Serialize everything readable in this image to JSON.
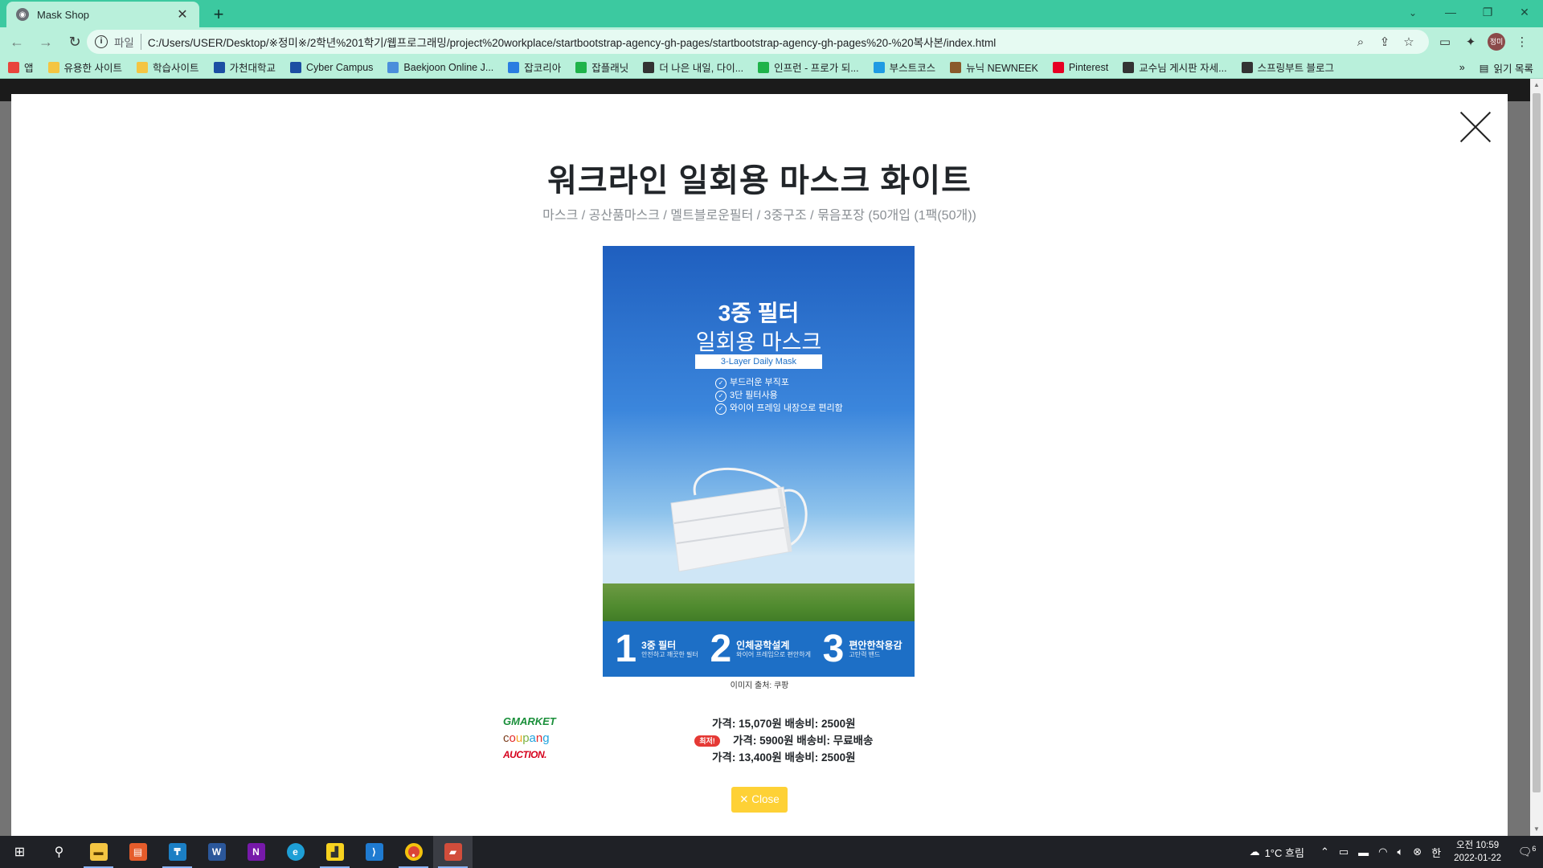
{
  "browser": {
    "tab_title": "Mask Shop",
    "tab_close": "✕",
    "new_tab": "+",
    "scheme_label": "파일",
    "url": "C:/Users/USER/Desktop/※정미※/2학년%201학기/웹프로그래밍/project%20workplace/startbootstrap-agency-gh-pages/startbootstrap-agency-gh-pages%20-%20복사본/index.html",
    "profile_initials": "정미",
    "bookmarks": [
      {
        "label": "앱",
        "color": "#e8453c"
      },
      {
        "label": "유용한 사이트",
        "color": "#f4c542"
      },
      {
        "label": "학습사이트",
        "color": "#f4c542"
      },
      {
        "label": "가천대학교",
        "color": "#1c4fa3"
      },
      {
        "label": "Cyber Campus",
        "color": "#1c4fa3"
      },
      {
        "label": "Baekjoon Online J...",
        "color": "#4b8edb"
      },
      {
        "label": "잡코리아",
        "color": "#2a7de1"
      },
      {
        "label": "잡플래닛",
        "color": "#1fb34a"
      },
      {
        "label": "더 나은 내일, 다이...",
        "color": "#333333"
      },
      {
        "label": "인프런 - 프로가 되...",
        "color": "#1fb34a"
      },
      {
        "label": "부스트코스",
        "color": "#1f9be3"
      },
      {
        "label": "뉴닉 NEWNEEK",
        "color": "#8a5a2b"
      },
      {
        "label": "Pinterest",
        "color": "#e60023"
      },
      {
        "label": "교수님 게시판 자세...",
        "color": "#333333"
      },
      {
        "label": "스프링부트 블로그",
        "color": "#333333"
      }
    ],
    "bookmarks_more": "»",
    "reading_list": "읽기 목록"
  },
  "product": {
    "title": "워크라인 일회용 마스크 화이트",
    "subtitle": "마스크 / 공산품마스크 / 멜트블로운필터 / 3중구조 / 묶음포장 (50개입 (1팩(50개))",
    "image": {
      "headline": "3중 필터",
      "subheadline": "일회용 마스크",
      "badge": "3-Layer Daily Mask",
      "checks": [
        "부드러운 부직포",
        "3단 필터사용",
        "와이어 프레임 내장으로 편리함"
      ],
      "features": [
        {
          "num": "1",
          "title": "3중 필터",
          "sub": "안전하고 깨끗한 필터"
        },
        {
          "num": "2",
          "title": "인체공학설계",
          "sub": "와이어 프레임으로 편안하게"
        },
        {
          "num": "3",
          "title": "편안한착용감",
          "sub": "고탄력 밴드"
        }
      ]
    },
    "image_caption": "이미지 출처: 쿠팡",
    "shops": [
      {
        "name": "GMARKET",
        "price_text": "가격: 15,070원 배송비: 2500원",
        "best": false
      },
      {
        "name": "coupang",
        "price_text": "가격: 5900원 배송비: 무료배송",
        "best": true
      },
      {
        "name": "AUCTION.",
        "price_text": "가격: 13,400원 배송비: 2500원",
        "best": false
      }
    ],
    "best_badge": "최저!",
    "close_button": "Close"
  },
  "taskbar": {
    "weather": "1°C 흐림",
    "ime": "한",
    "time": "오전 10:59",
    "date": "2022-01-22",
    "notifications": "6"
  }
}
